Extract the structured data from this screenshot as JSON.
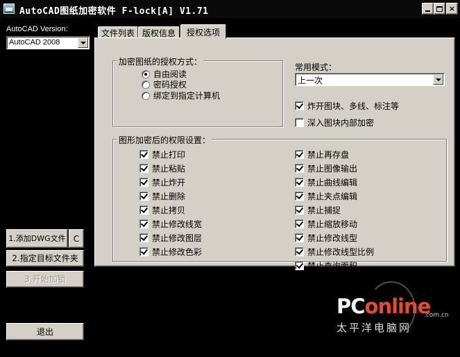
{
  "window": {
    "title": "AutoCAD图纸加密软件 F-lock[A] V1.71",
    "controls": {
      "minimize": "_",
      "maximize": "□",
      "close": "×"
    }
  },
  "sidebar": {
    "version_label": "AutoCAD Version:",
    "version_value": "AutoCAD 2008",
    "add_dwg_label": "1.添加DWG文件",
    "clear_label": "C",
    "target_folder_label": "2.指定目标文件夹",
    "start_encrypt_label": "3.开始加锁",
    "exit_label": "退出"
  },
  "tabs": [
    {
      "label": "文件列表",
      "active": false
    },
    {
      "label": "版权信息",
      "active": false
    },
    {
      "label": "授权选项",
      "active": true
    }
  ],
  "auth_method": {
    "title": "加密图纸的授权方式：",
    "options": [
      {
        "label": "自由阅读",
        "selected": true
      },
      {
        "label": "密码授权",
        "selected": false
      },
      {
        "label": "绑定到指定计算机",
        "selected": false
      }
    ]
  },
  "common_mode": {
    "label": "常用模式：",
    "value": "上一次",
    "options": [
      {
        "label": "炸开图块、多线、标注等",
        "checked": true
      },
      {
        "label": "深入图块内部加密",
        "checked": false
      }
    ]
  },
  "permissions": {
    "title": "图形加密后的权限设置：",
    "left": [
      {
        "label": "禁止打印",
        "checked": true
      },
      {
        "label": "禁止粘贴",
        "checked": true
      },
      {
        "label": "禁止炸开",
        "checked": true
      },
      {
        "label": "禁止删除",
        "checked": true
      },
      {
        "label": "禁止拷贝",
        "checked": true
      },
      {
        "label": "禁止修改线宽",
        "checked": true
      },
      {
        "label": "禁止修改图层",
        "checked": true
      },
      {
        "label": "禁止修改色彩",
        "checked": true
      }
    ],
    "right": [
      {
        "label": "禁止再存盘",
        "checked": true
      },
      {
        "label": "禁止图像输出",
        "checked": true
      },
      {
        "label": "禁止曲线编辑",
        "checked": true
      },
      {
        "label": "禁止夹点编辑",
        "checked": true
      },
      {
        "label": "禁止捕捉",
        "checked": true
      },
      {
        "label": "禁止缩放移动",
        "checked": true
      },
      {
        "label": "禁止修改线型",
        "checked": true
      },
      {
        "label": "禁止修改线型比例",
        "checked": true
      },
      {
        "label": "禁止查询面积",
        "checked": true
      }
    ]
  },
  "watermark": {
    "logo_prefix": "PC",
    "logo_suffix": "online",
    "domain": ".com.cn",
    "chinese": "太平洋电脑网"
  },
  "colors": {
    "background": "#000000",
    "dialog_face": "#d4d0c8",
    "watermark_accent": "#e84a2e"
  }
}
